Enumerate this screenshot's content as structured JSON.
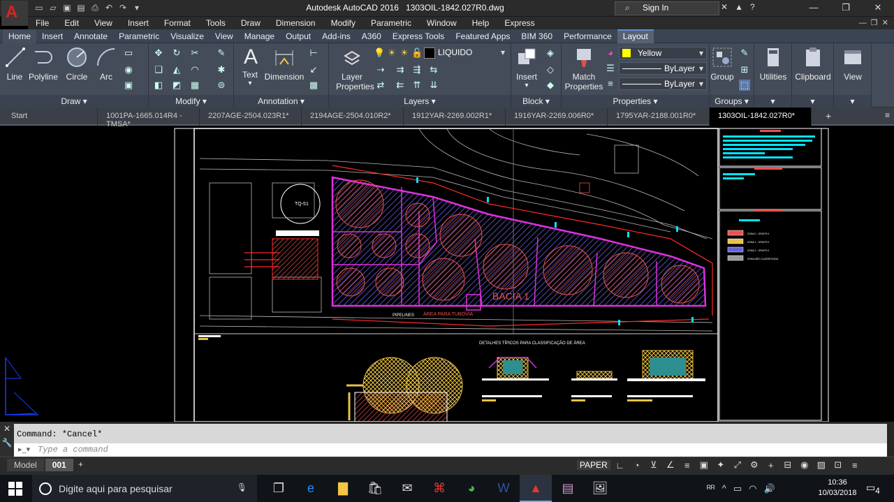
{
  "titlebar": {
    "app": "Autodesk AutoCAD 2016",
    "file": "1303OIL-1842.027R0.dwg",
    "sign_in": "Sign In"
  },
  "menu": [
    "File",
    "Edit",
    "View",
    "Insert",
    "Format",
    "Tools",
    "Draw",
    "Dimension",
    "Modify",
    "Parametric",
    "Window",
    "Help",
    "Express"
  ],
  "ribbon_tabs": [
    "Home",
    "Insert",
    "Annotate",
    "Parametric",
    "Visualize",
    "View",
    "Manage",
    "Output",
    "Add-ins",
    "A360",
    "Express Tools",
    "Featured Apps",
    "BIM 360",
    "Performance",
    "Layout"
  ],
  "ribbon_active": "Home",
  "ribbon_selected": "Layout",
  "draw": {
    "title": "Draw",
    "line": "Line",
    "polyline": "Polyline",
    "circle": "Circle",
    "arc": "Arc"
  },
  "modify": {
    "title": "Modify"
  },
  "annotation": {
    "title": "Annotation",
    "text": "Text",
    "dimension": "Dimension"
  },
  "layers": {
    "title": "Layers",
    "layer_properties": "Layer Properties",
    "current_layer": "LIQUIDO"
  },
  "block": {
    "title": "Block",
    "insert": "Insert"
  },
  "properties": {
    "title": "Properties",
    "match": "Match Properties",
    "color": "Yellow",
    "linetype": "ByLayer",
    "lineweight": "ByLayer",
    "color_hex": "#ffff00"
  },
  "groups": {
    "title": "Groups",
    "group": "Group"
  },
  "utilities": {
    "label": "Utilities"
  },
  "clipboard": {
    "label": "Clipboard"
  },
  "view": {
    "label": "View"
  },
  "doc_tabs": [
    "Start",
    "1001PA-1665.014R4 - TMSA*",
    "2207AGE-2504.023R1*",
    "2194AGE-2504.010R2*",
    "1912YAR-2269.002R1*",
    "1916YAR-2269.006R0*",
    "1795YAR-2188.001R0*",
    "1303OIL-1842.027R0*"
  ],
  "drawing": {
    "basin_label": "BACIA 1",
    "area_label": "ÁREA  PARA  TUBOVIA",
    "pipelines": "PIPELINES",
    "tank_label": "TQ-51",
    "details_title": "DETALHES TÍPICOS PARA CLASSIFICAÇÃO DE ÁREA",
    "legend": [
      {
        "label": "ZONA 0 - GRUPO II",
        "color": "#e9524f"
      },
      {
        "label": "ZONA 1 - GRUPO II",
        "color": "#e8c14a"
      },
      {
        "label": "ZONA 2 - GRUPO II",
        "color": "#6b5fe0"
      },
      {
        "label": "ZONA NÃO CLASSIFICADA",
        "color": "#999999"
      }
    ]
  },
  "command": {
    "history": "Command: *Cancel*",
    "placeholder": "Type a command"
  },
  "layout_tabs": [
    "Model",
    "001"
  ],
  "status": {
    "paper": "PAPER"
  },
  "taskbar": {
    "search": "Digite aqui para pesquisar",
    "time": "10:36",
    "date": "10/03/2018",
    "notifications": "4"
  }
}
